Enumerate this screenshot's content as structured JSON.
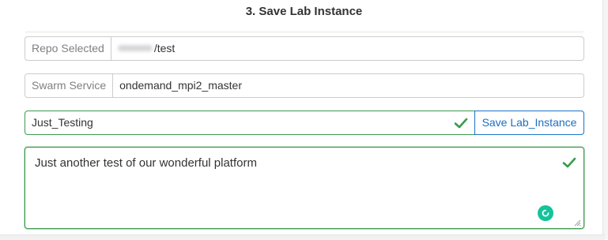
{
  "section": {
    "title": "3. Save Lab Instance"
  },
  "repo": {
    "label": "Repo Selected",
    "value": "/test"
  },
  "swarm": {
    "label": "Swarm Service",
    "value": "ondemand_mpi2_master"
  },
  "instance_name": {
    "value": "Just_Testing"
  },
  "save_button": {
    "label": "Save Lab_Instance"
  },
  "description": {
    "value": "Just another test of our wonderful platform"
  },
  "colors": {
    "valid_green": "#3c9a4e",
    "button_blue": "#1a73c8",
    "assistant_teal": "#15c39a"
  },
  "icons": [
    "check-icon",
    "grammar-assistant-icon",
    "resize-grip-icon"
  ]
}
